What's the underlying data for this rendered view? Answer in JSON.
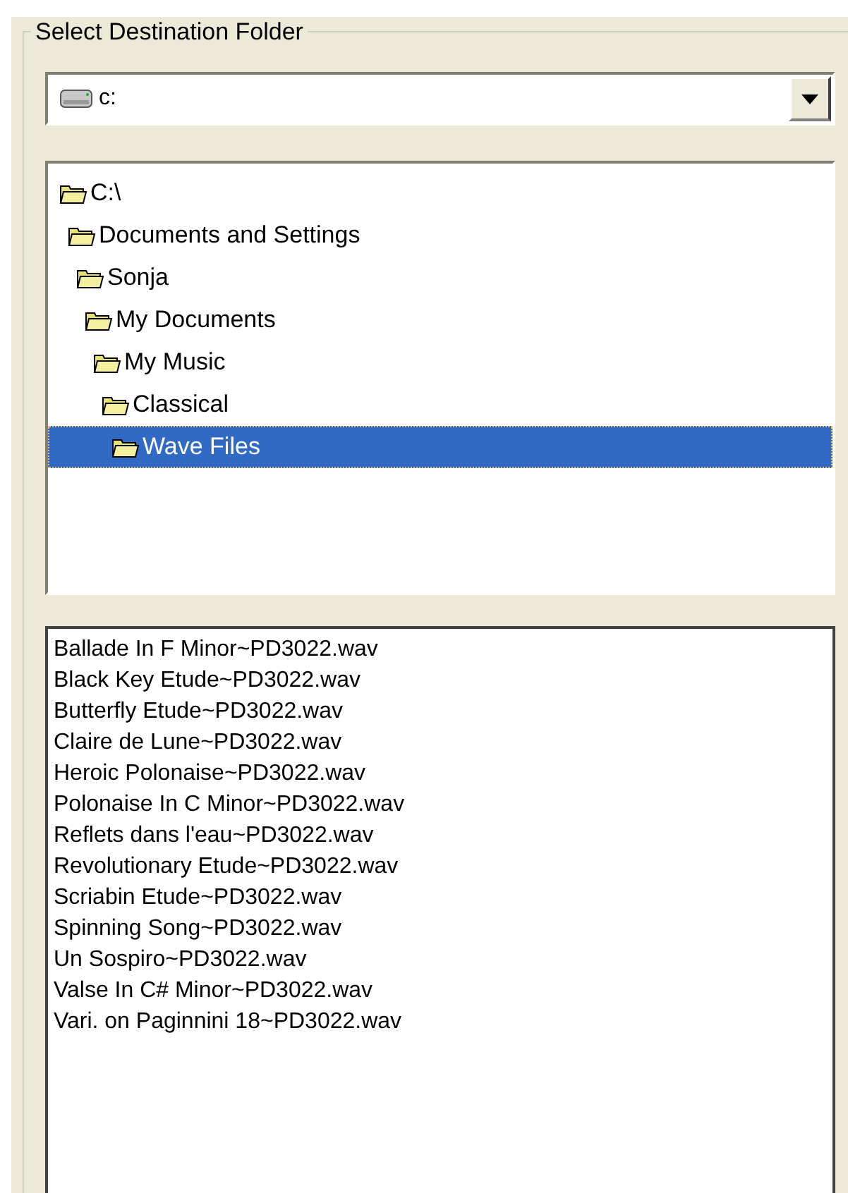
{
  "group_title": "Select Destination Folder",
  "drive_select": {
    "value": "c:"
  },
  "folder_tree": [
    {
      "label": "C:\\",
      "selected": false,
      "children": [
        {
          "label": "Documents and Settings",
          "selected": false,
          "children": [
            {
              "label": "Sonja",
              "selected": false,
              "children": [
                {
                  "label": "My Documents",
                  "selected": false,
                  "children": [
                    {
                      "label": "My Music",
                      "selected": false,
                      "children": [
                        {
                          "label": "Classical",
                          "selected": false,
                          "children": [
                            {
                              "label": "Wave Files",
                              "selected": true
                            }
                          ]
                        }
                      ]
                    }
                  ]
                }
              ]
            }
          ]
        }
      ]
    }
  ],
  "files": [
    "Ballade In F Minor~PD3022.wav",
    "Black Key Etude~PD3022.wav",
    "Butterfly Etude~PD3022.wav",
    "Claire de Lune~PD3022.wav",
    "Heroic Polonaise~PD3022.wav",
    "Polonaise In C Minor~PD3022.wav",
    "Reflets dans l'eau~PD3022.wav",
    "Revolutionary Etude~PD3022.wav",
    "Scriabin Etude~PD3022.wav",
    "Spinning Song~PD3022.wav",
    "Un Sospiro~PD3022.wav",
    "Valse In C# Minor~PD3022.wav",
    "Vari. on Paginnini 18~PD3022.wav"
  ]
}
